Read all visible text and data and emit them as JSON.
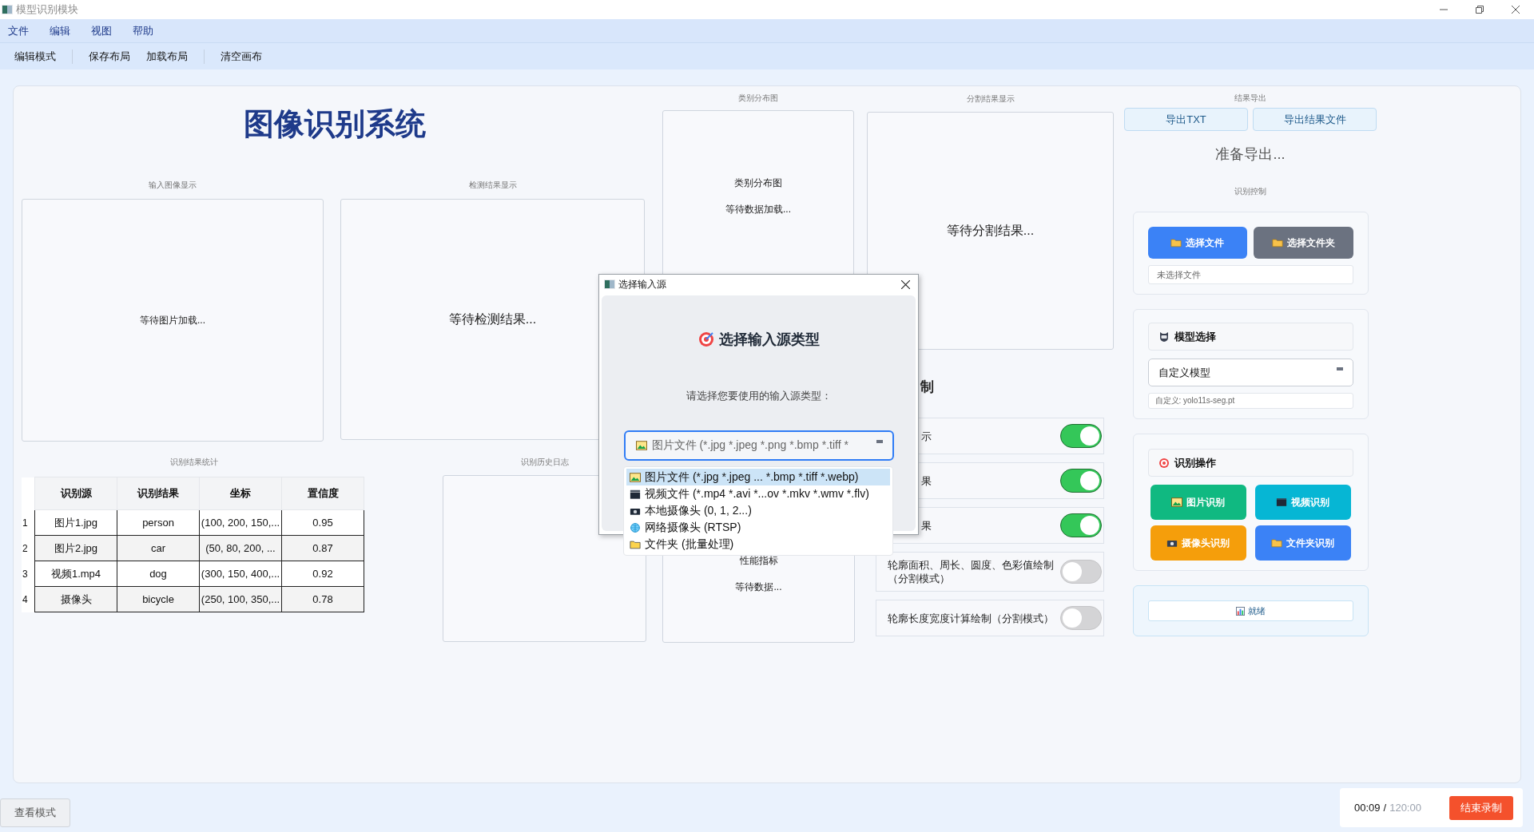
{
  "window": {
    "title": "模型识别模块"
  },
  "menu": [
    "文件",
    "编辑",
    "视图",
    "帮助"
  ],
  "toolbar": [
    [
      "编辑模式"
    ],
    [
      "保存布局",
      "加载布局"
    ],
    [
      "清空画布"
    ]
  ],
  "app_title": "图像识别系统",
  "input_view": {
    "caption": "输入图像显示",
    "placeholder": "等待图片加载..."
  },
  "detection_view": {
    "caption": "检测结果显示",
    "placeholder": "等待检测结果..."
  },
  "category_chart": {
    "caption": "类别分布图",
    "title": "类别分布图",
    "placeholder": "等待数据加载..."
  },
  "performance": {
    "title": "性能指标",
    "placeholder": "等待数据..."
  },
  "segmentation_view": {
    "caption": "分割结果显示",
    "placeholder": "等待分割结果..."
  },
  "display_control": {
    "heading": "制",
    "options": [
      {
        "label": "示",
        "kind": "covered",
        "on": true
      },
      {
        "label": "果",
        "kind": "covered",
        "on": true
      },
      {
        "label": "果",
        "kind": "covered",
        "on": true
      },
      {
        "label": "轮廓面积、周长、圆度、色彩值绘制（分割模式）",
        "kind": "full",
        "on": false
      },
      {
        "label": "轮廓长度宽度计算绘制（分割模式）",
        "kind": "full",
        "on": false
      }
    ]
  },
  "stats": {
    "caption": "识别结果统计",
    "columns": [
      "识别源",
      "识别结果",
      "坐标",
      "置信度"
    ],
    "rows": [
      {
        "index": "1",
        "cells": [
          "图片1.jpg",
          "person",
          "(100, 200, 150,...",
          "0.95"
        ]
      },
      {
        "index": "2",
        "cells": [
          "图片2.jpg",
          "car",
          "(50, 80, 200, ...",
          "0.87"
        ]
      },
      {
        "index": "3",
        "cells": [
          "视频1.mp4",
          "dog",
          "(300, 150, 400,...",
          "0.92"
        ]
      },
      {
        "index": "4",
        "cells": [
          "摄像头",
          "bicycle",
          "(250, 100, 350,...",
          "0.78"
        ]
      }
    ]
  },
  "history_log": {
    "caption": "识别历史日志"
  },
  "export": {
    "caption": "结果导出",
    "buttons": [
      "导出TXT",
      "导出结果文件"
    ],
    "status": "准备导出..."
  },
  "control": {
    "caption": "识别控制",
    "file_buttons": [
      {
        "label": "选择文件",
        "kind": "primary"
      },
      {
        "label": "选择文件夹",
        "kind": "secondary"
      }
    ],
    "file_status": "未选择文件"
  },
  "model": {
    "header": "模型选择",
    "value": "自定义模型",
    "custom_path": "自定义: yolo11s-seg.pt"
  },
  "actions": {
    "header": "识别操作",
    "buttons": [
      {
        "label": "图片识别",
        "kind": "image"
      },
      {
        "label": "视频识别",
        "kind": "video"
      },
      {
        "label": "摄像头识别",
        "kind": "camera"
      },
      {
        "label": "文件夹识别",
        "kind": "folder"
      }
    ]
  },
  "status": "就绪",
  "view_mode_button": "查看模式",
  "recording": {
    "elapsed": "00:09",
    "separator": "/",
    "limit": "120:00",
    "stop_button": "结束录制"
  },
  "dialog": {
    "title": "选择输入源",
    "heading": "选择输入源类型",
    "prompt": "请选择您要使用的输入源类型：",
    "combo_value": "图片文件 (*.jpg *.jpeg *.png *.bmp *.tiff *",
    "options": [
      {
        "label": "图片文件 (*.jpg *.jpeg ... *.bmp *.tiff *.webp)",
        "kind": "image",
        "selected": true
      },
      {
        "label": "视频文件 (*.mp4 *.avi *...ov *.mkv *.wmv *.flv)",
        "kind": "video",
        "selected": false
      },
      {
        "label": "本地摄像头 (0, 1, 2...)",
        "kind": "camera",
        "selected": false
      },
      {
        "label": "网络摄像头 (RTSP)",
        "kind": "globe",
        "selected": false
      },
      {
        "label": "文件夹 (批量处理)",
        "kind": "folder",
        "selected": false
      }
    ]
  }
}
